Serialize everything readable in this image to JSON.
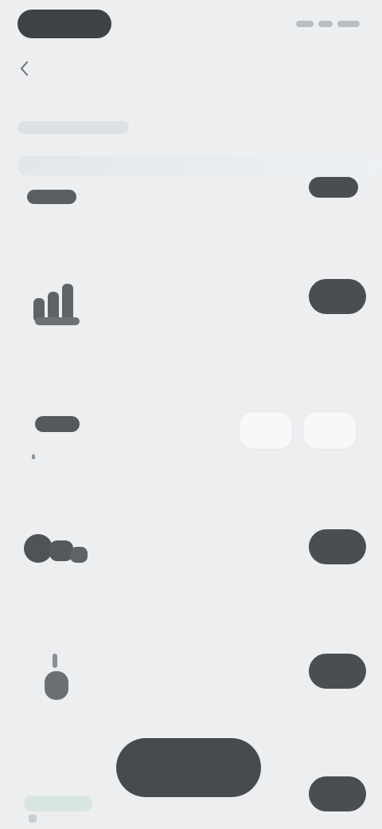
{
  "top": {
    "status_left": "",
    "status_right": ""
  },
  "header": {
    "title": "",
    "tab": ""
  },
  "rows": [
    {
      "title": "",
      "subtitle": "",
      "toggle": true
    },
    {
      "title": "",
      "subtitle": "",
      "toggle": true
    },
    {
      "title": "",
      "subtitle": "",
      "detail": "",
      "toggle": false
    },
    {
      "title": "",
      "subtitle": "",
      "toggle": true
    },
    {
      "title": "",
      "subtitle": "",
      "toggle": true
    },
    {
      "title": "",
      "subtitle": "",
      "toggle": true
    }
  ],
  "bottom": {
    "action_label": ""
  },
  "colors": {
    "background": "#eceef0",
    "toggle_on": "#4a4e52",
    "toggle_off": "#f6f7f8",
    "action": "#474b4f"
  },
  "icons": {
    "back": "chevron-left-icon",
    "row1": "bar-chart-icon",
    "row2": "minus-icon",
    "row3": "shapes-icon",
    "row4": "cursor-icon",
    "row5": "tag-icon"
  }
}
